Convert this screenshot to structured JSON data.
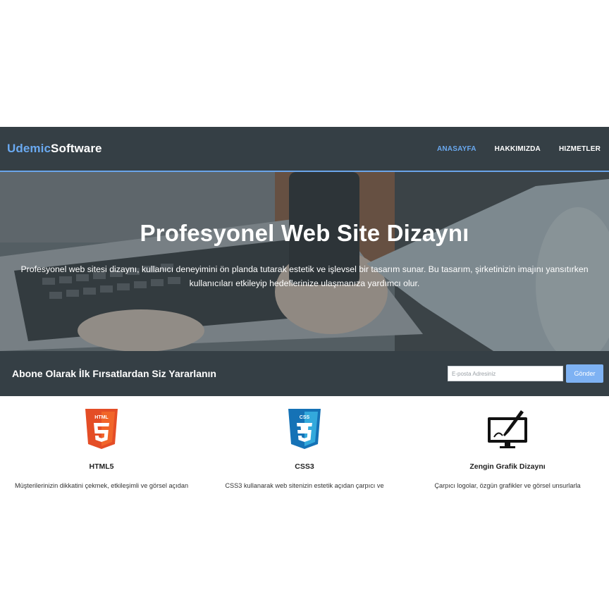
{
  "header": {
    "logo_accent": "Udemic",
    "logo_main": "Software",
    "nav": [
      {
        "label": "ANASAYFA",
        "active": true
      },
      {
        "label": "HAKKIMIZDA",
        "active": false
      },
      {
        "label": "HIZMETLER",
        "active": false
      }
    ]
  },
  "hero": {
    "title": "Profesyonel Web Site Dizaynı",
    "text_line1": "Profesyonel web sitesi dizaynı, kullanıcı deneyimini ön planda tutarak estetik ve işlevsel bir tasarım sunar. Bu tasarım, şirketinizin imajını yansıtırken",
    "text_line2": "kullanıcıları etkileyip hedeflerinize ulaşmanıza yardımcı olur."
  },
  "subscribe": {
    "title": "Abone Olarak İlk Fırsatlardan Siz Yararlanın",
    "email_placeholder": "E-posta Adresiniz",
    "button_label": "Gönder"
  },
  "features": [
    {
      "icon": "html5-icon",
      "title": "HTML5",
      "text": "Müşterilerinizin dikkatini çekmek, etkileşimli ve görsel açıdan"
    },
    {
      "icon": "css3-icon",
      "title": "CSS3",
      "text": "CSS3 kullanarak web sitenizin estetik açıdan çarpıcı ve"
    },
    {
      "icon": "graphic-design-icon",
      "title": "Zengin Grafik Dizaynı",
      "text": "Çarpıcı logolar, özgün grafikler ve görsel unsurlarla"
    }
  ],
  "colors": {
    "header_bg": "#353f45",
    "accent": "#6aa9f0",
    "button": "#7eb2f3",
    "html5_orange": "#e44d26",
    "css3_blue": "#1572b6"
  }
}
